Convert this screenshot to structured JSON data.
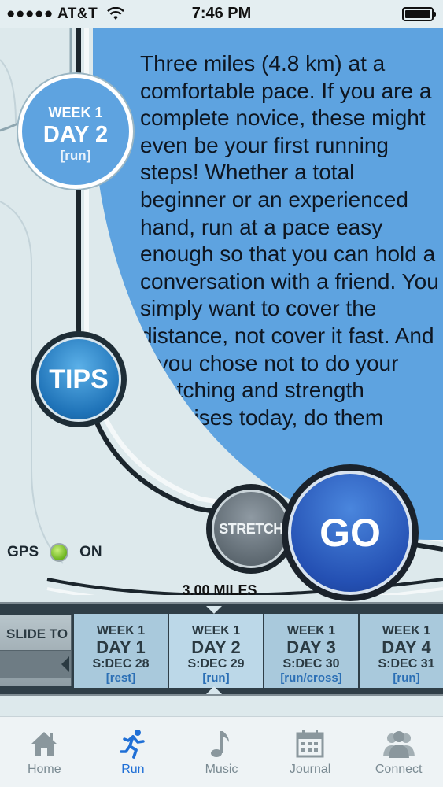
{
  "status_bar": {
    "carrier": "●●●●● AT&T",
    "time": "7:46 PM"
  },
  "workout": {
    "week": "WEEK 1",
    "day": "DAY 2",
    "type": "[run]",
    "description": "Three miles (4.8 km) at a comfortable pace. If you are a complete novice, these might even be your first running steps! Whether a total beginner or an experienced hand, run at a pace easy enough so that you can hold a conversation with a friend. You simply want to cover the distance, not cover it fast. And if you chose not to do your stretching and strength exercises today, do them"
  },
  "buttons": {
    "tips": "TIPS",
    "stretch": "STRETCH",
    "go": "GO"
  },
  "gps": {
    "label": "GPS",
    "state": "ON"
  },
  "distance": "3.00 MILES",
  "slider": {
    "label": "SLIDE TO"
  },
  "days": [
    {
      "week": "WEEK 1",
      "day": "DAY 1",
      "start": "S:DEC 28",
      "type": "[rest]"
    },
    {
      "week": "WEEK 1",
      "day": "DAY 2",
      "start": "S:DEC 29",
      "type": "[run]"
    },
    {
      "week": "WEEK 1",
      "day": "DAY 3",
      "start": "S:DEC 30",
      "type": "[run/cross]"
    },
    {
      "week": "WEEK 1",
      "day": "DAY 4",
      "start": "S:DEC 31",
      "type": "[run]"
    }
  ],
  "tabs": [
    {
      "label": "Home",
      "icon": "home-icon"
    },
    {
      "label": "Run",
      "icon": "runner-icon"
    },
    {
      "label": "Music",
      "icon": "music-note-icon"
    },
    {
      "label": "Journal",
      "icon": "calendar-icon"
    },
    {
      "label": "Connect",
      "icon": "people-icon"
    }
  ],
  "colors": {
    "panel_blue": "#5ea3e0",
    "go_blue": "#2450b3",
    "active_tab": "#1f6fd6",
    "gps_green": "#6bb31e"
  }
}
